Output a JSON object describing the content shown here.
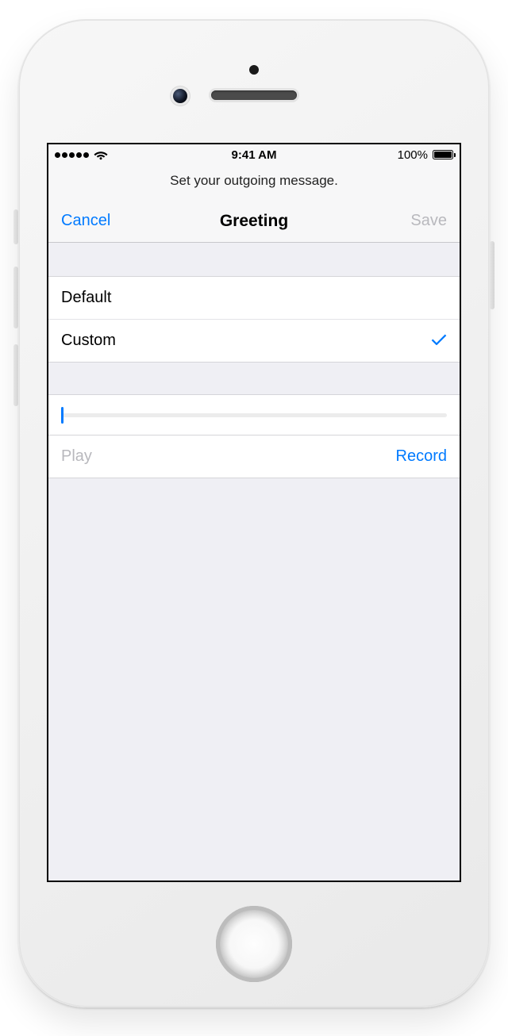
{
  "status": {
    "time": "9:41 AM",
    "battery_pct": "100%"
  },
  "hint": "Set your outgoing message.",
  "nav": {
    "cancel": "Cancel",
    "title": "Greeting",
    "save": "Save"
  },
  "options": {
    "default": "Default",
    "custom": "Custom"
  },
  "controls": {
    "play": "Play",
    "record": "Record"
  }
}
